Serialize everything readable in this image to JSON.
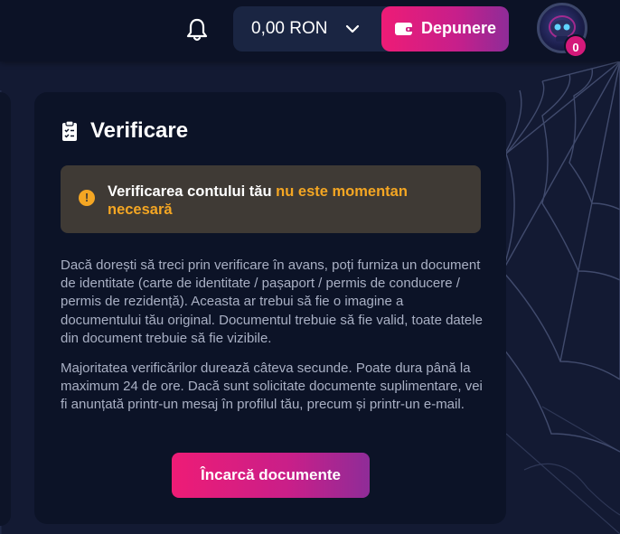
{
  "header": {
    "balance": "0,00 RON",
    "deposit_label": "Depunere",
    "notifications_count": "0"
  },
  "verification": {
    "title": "Verificare",
    "alert_text": "Verificarea contului tău",
    "alert_highlight": "nu este momentan necesară",
    "paragraph_1": "Dacă dorești să treci prin verificare în avans, poți furniza un document de identitate (carte de identitate / pașaport / permis de conducere / permis de rezidență). Aceasta ar trebui să fie o imagine a documentului tău original. Documentul trebuie să fie valid, toate datele din document trebuie să fie vizibile.",
    "paragraph_2": "Majoritatea verificărilor durează câteva secunde. Poate dura până la maximum 24 de ore. Dacă sunt solicitate documente suplimentare, vei fi anunțată printr-un mesaj în profilul tău, precum și printr-un e-mail.",
    "upload_label": "Încarcă documente"
  },
  "colors": {
    "accent_pink": "#ee1c76",
    "accent_purple": "#8e2c98",
    "warning": "#f4a623",
    "card_bg": "#0c1327",
    "page_bg": "#131a33"
  },
  "icons": {
    "bell": "bell-icon",
    "chevron": "chevron-down-icon",
    "wallet": "wallet-icon",
    "clipboard": "clipboard-check-icon",
    "warning": "warning-icon"
  }
}
